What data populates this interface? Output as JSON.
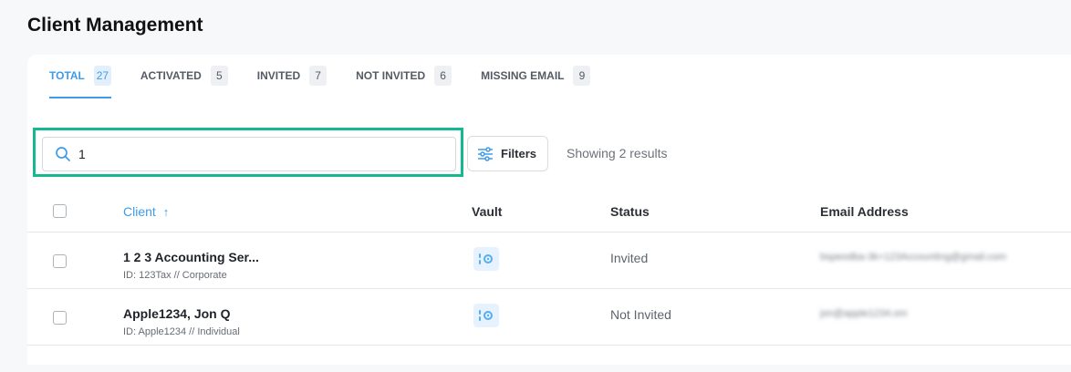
{
  "page": {
    "title": "Client Management"
  },
  "tabs": [
    {
      "label": "TOTAL",
      "count": "27",
      "active": true
    },
    {
      "label": "ACTIVATED",
      "count": "5",
      "active": false
    },
    {
      "label": "INVITED",
      "count": "7",
      "active": false
    },
    {
      "label": "NOT INVITED",
      "count": "6",
      "active": false
    },
    {
      "label": "MISSING EMAIL",
      "count": "9",
      "active": false
    }
  ],
  "search": {
    "value": "1",
    "placeholder": ""
  },
  "filters": {
    "label": "Filters"
  },
  "results": {
    "text": "Showing 2 results"
  },
  "table": {
    "headers": {
      "client": "Client",
      "client_sort_arrow": "↑",
      "vault": "Vault",
      "status": "Status",
      "email": "Email Address"
    },
    "rows": [
      {
        "name": "1 2 3 Accounting Ser...",
        "sub": "ID: 123Tax // Corporate",
        "status": "Invited",
        "email": "bspeodba-3k+123Accounting@gmail.com"
      },
      {
        "name": "Apple1234, Jon Q",
        "sub": "ID: Apple1234 // Individual",
        "status": "Not Invited",
        "email": "jon@apple1234.om"
      }
    ]
  },
  "colors": {
    "accent": "#3d9be9",
    "highlight": "#16b891"
  },
  "icons": {
    "search": "search-icon",
    "filters": "sliders-icon",
    "vault": "vault-icon",
    "sort": "arrow-up-icon"
  }
}
